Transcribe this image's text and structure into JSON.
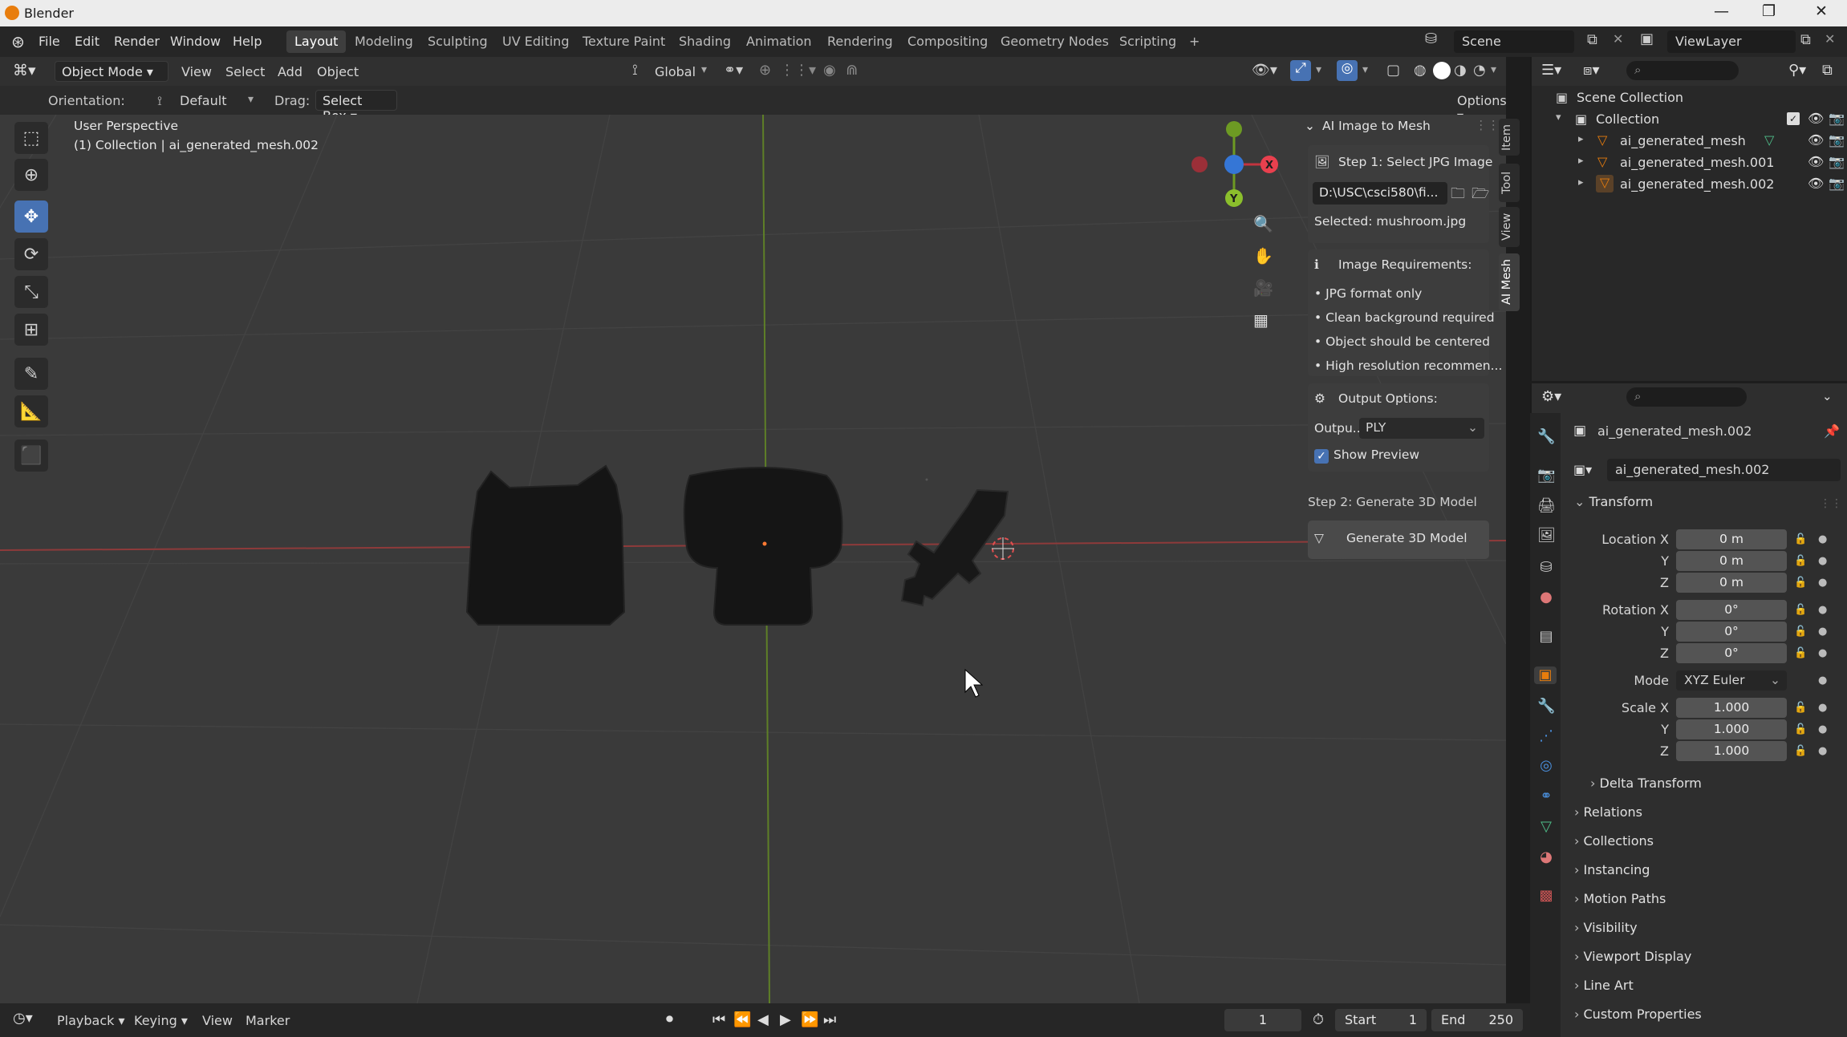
{
  "window": {
    "title": "Blender",
    "controls": [
      "—",
      "❐",
      "✕"
    ]
  },
  "menu": [
    "File",
    "Edit",
    "Render",
    "Window",
    "Help"
  ],
  "workspaces": [
    "Layout",
    "Modeling",
    "Sculpting",
    "UV Editing",
    "Texture Paint",
    "Shading",
    "Animation",
    "Rendering",
    "Compositing",
    "Geometry Nodes",
    "Scripting",
    "+"
  ],
  "active_workspace": "Layout",
  "scene": {
    "name": "Scene",
    "view_layer": "ViewLayer"
  },
  "viewport_header": {
    "mode": "Object Mode",
    "menus": [
      "View",
      "Select",
      "Add",
      "Object"
    ],
    "transform_orientation": "Global",
    "orientation_label": "Orientation:",
    "orientation_value": "Default",
    "drag_label": "Drag:",
    "drag_value": "Select Box",
    "options_label": "Options"
  },
  "viewport": {
    "perspective_label": "User Perspective",
    "collection_label": "(1) Collection | ai_generated_mesh.002"
  },
  "n_panel": {
    "title": "AI Image to Mesh",
    "step1_label": "Step 1: Select JPG Image",
    "file_path": "D:\\USC\\csci580\\fi...",
    "selected_label": "Selected: mushroom.jpg",
    "requirements_title": "Image Requirements:",
    "requirements": [
      "• JPG format only",
      "• Clean background required",
      "• Object should be centered",
      "• High resolution recommen..."
    ],
    "output_title": "Output Options:",
    "output_label": "Outpu...",
    "output_value": "PLY",
    "show_preview_label": "Show Preview",
    "show_preview_checked": true,
    "step2_label": "Step 2: Generate 3D Model",
    "generate_button": "Generate 3D Model",
    "tabs": [
      "Item",
      "Tool",
      "View",
      "AI Mesh"
    ],
    "active_tab": "AI Mesh"
  },
  "outliner": {
    "scene_collection": "Scene Collection",
    "collection": "Collection",
    "objects": [
      "ai_generated_mesh",
      "ai_generated_mesh.001",
      "ai_generated_mesh.002"
    ]
  },
  "properties": {
    "object_name": "ai_generated_mesh.002",
    "data_name": "ai_generated_mesh.002",
    "transform_title": "Transform",
    "location_label": "Location X",
    "rotation_label": "Rotation X",
    "scale_label": "Scale X",
    "axis_y": "Y",
    "axis_z": "Z",
    "location": [
      "0 m",
      "0 m",
      "0 m"
    ],
    "rotation": [
      "0°",
      "0°",
      "0°"
    ],
    "mode_label": "Mode",
    "mode_value": "XYZ Euler",
    "scale": [
      "1.000",
      "1.000",
      "1.000"
    ],
    "delta_transform": "Delta Transform",
    "sections": [
      "Relations",
      "Collections",
      "Instancing",
      "Motion Paths",
      "Visibility",
      "Viewport Display",
      "Line Art",
      "Custom Properties"
    ]
  },
  "timeline": {
    "menus": [
      "Playback",
      "Keying",
      "View",
      "Marker"
    ],
    "current_frame": "1",
    "start_label": "Start",
    "start": "1",
    "end_label": "End",
    "end": "250"
  },
  "colors": {
    "accent": "#4772b3",
    "x_axis": "#ff3352",
    "y_axis": "#8bdc00",
    "z_axis": "#2890ff",
    "mesh_icon": "#e87d0d"
  }
}
